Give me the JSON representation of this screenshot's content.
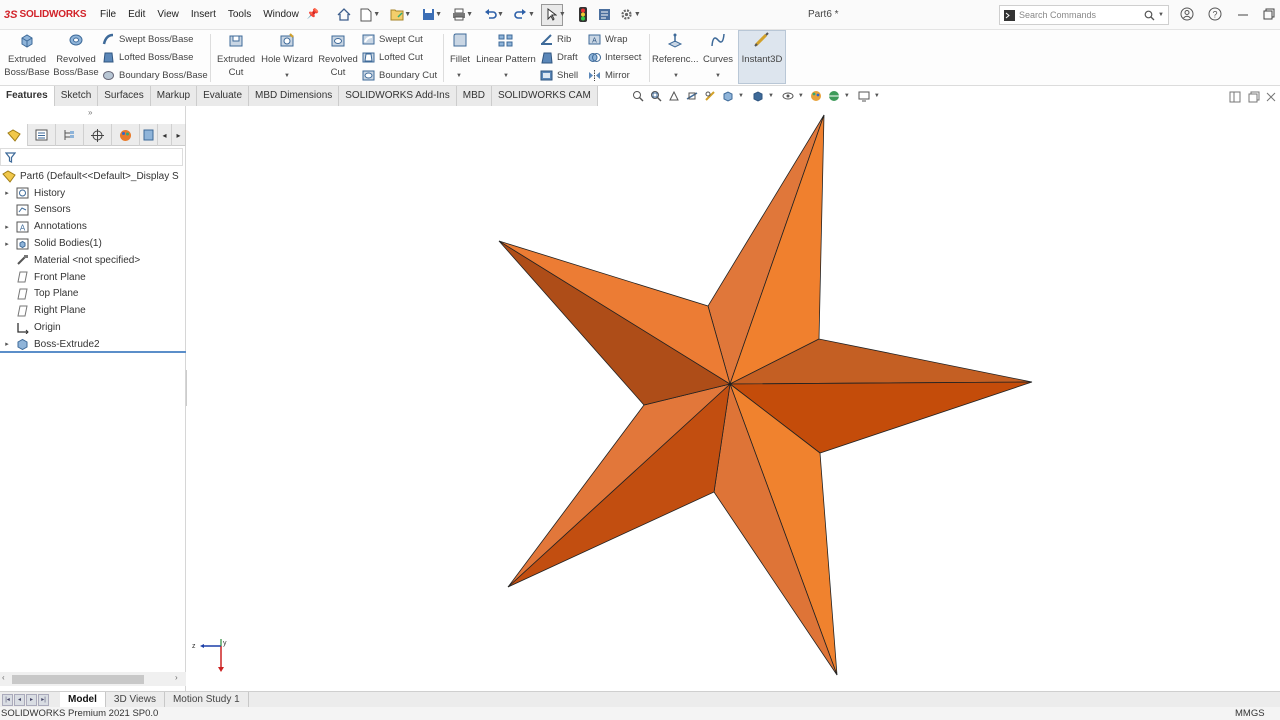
{
  "app": {
    "logo_ds": "3S",
    "logo_text": "SOLIDWORKS",
    "document_title": "Part6 *"
  },
  "menu": [
    "File",
    "Edit",
    "View",
    "Insert",
    "Tools",
    "Window"
  ],
  "search": {
    "placeholder": "Search Commands"
  },
  "ribbon": {
    "extruded_boss": [
      "Extruded",
      "Boss/Base"
    ],
    "revolved_boss": [
      "Revolved",
      "Boss/Base"
    ],
    "swept_boss": "Swept Boss/Base",
    "lofted_boss": "Lofted Boss/Base",
    "boundary_boss": "Boundary Boss/Base",
    "extruded_cut": [
      "Extruded",
      "Cut"
    ],
    "hole_wizard": "Hole Wizard",
    "revolved_cut": [
      "Revolved",
      "Cut"
    ],
    "swept_cut": "Swept Cut",
    "lofted_cut": "Lofted Cut",
    "boundary_cut": "Boundary Cut",
    "fillet": "Fillet",
    "linear_pattern": "Linear Pattern",
    "rib": "Rib",
    "draft": "Draft",
    "shell": "Shell",
    "wrap": "Wrap",
    "intersect": "Intersect",
    "mirror": "Mirror",
    "reference": "Referenc...",
    "curves": "Curves",
    "instant3d": "Instant3D"
  },
  "command_tabs": [
    "Features",
    "Sketch",
    "Surfaces",
    "Markup",
    "Evaluate",
    "MBD Dimensions",
    "SOLIDWORKS Add-Ins",
    "MBD",
    "SOLIDWORKS CAM"
  ],
  "feature_tree": {
    "root": "Part6  (Default<<Default>_Display S",
    "items": [
      {
        "label": "History",
        "expandable": true,
        "icon": "history-icon"
      },
      {
        "label": "Sensors",
        "expandable": false,
        "icon": "sensors-icon"
      },
      {
        "label": "Annotations",
        "expandable": true,
        "icon": "annotations-icon"
      },
      {
        "label": "Solid Bodies(1)",
        "expandable": true,
        "icon": "solid-bodies-icon"
      },
      {
        "label": "Material <not specified>",
        "expandable": false,
        "icon": "material-icon"
      },
      {
        "label": "Front Plane",
        "expandable": false,
        "icon": "plane-icon"
      },
      {
        "label": "Top Plane",
        "expandable": false,
        "icon": "plane-icon"
      },
      {
        "label": "Right Plane",
        "expandable": false,
        "icon": "plane-icon"
      },
      {
        "label": "Origin",
        "expandable": false,
        "icon": "origin-icon"
      },
      {
        "label": "Boss-Extrude2",
        "expandable": true,
        "icon": "boss-extrude-icon"
      }
    ]
  },
  "bottom_tabs": [
    "Model",
    "3D Views",
    "Motion Study 1"
  ],
  "status": {
    "version": "SOLIDWORKS Premium 2021 SP0.0",
    "units": "MMGS"
  },
  "triad": {
    "y_label": "y",
    "z_label": "z"
  },
  "colors": {
    "accent": "#d2232a",
    "star_orange": "#e8702a",
    "tree_highlight": "#5b8ec9"
  }
}
